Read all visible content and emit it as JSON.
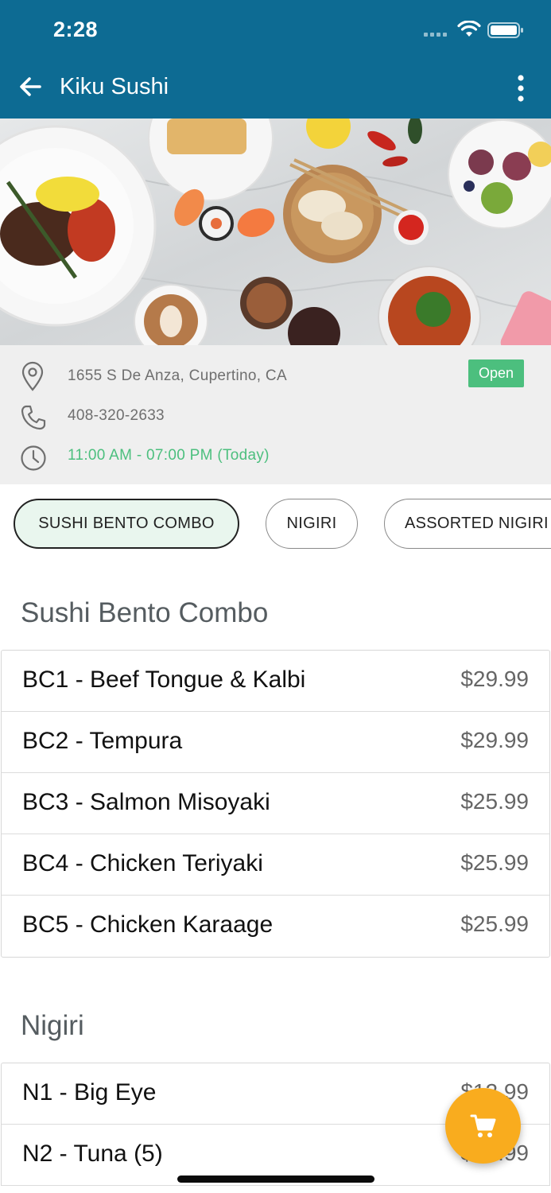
{
  "status_bar": {
    "time": "2:28"
  },
  "app_bar": {
    "title": "Kiku Sushi",
    "back_icon": "arrow-left-icon",
    "menu_icon": "more-vertical-icon"
  },
  "restaurant": {
    "address": "1655 S De Anza, Cupertino, CA",
    "phone": "408-320-2633",
    "hours": "11:00 AM - 07:00 PM (Today)",
    "status": "Open"
  },
  "categories": [
    {
      "label": "SUSHI BENTO COMBO",
      "active": true
    },
    {
      "label": "NIGIRI",
      "active": false
    },
    {
      "label": "ASSORTED NIGIRI",
      "active": false
    }
  ],
  "sections": [
    {
      "title": "Sushi Bento Combo",
      "items": [
        {
          "name": "BC1 - Beef Tongue & Kalbi",
          "price": "$29.99"
        },
        {
          "name": "BC2 - Tempura",
          "price": "$29.99"
        },
        {
          "name": "BC3 - Salmon Misoyaki",
          "price": "$25.99"
        },
        {
          "name": "BC4 - Chicken Teriyaki",
          "price": "$25.99"
        },
        {
          "name": "BC5 - Chicken Karaage",
          "price": "$25.99"
        }
      ]
    },
    {
      "title": "Nigiri",
      "items": [
        {
          "name": "N1 - Big Eye",
          "price": "$12.99"
        },
        {
          "name": "N2 - Tuna (5)",
          "price": "$12.99"
        }
      ]
    }
  ],
  "colors": {
    "app_bar": "#0d6b93",
    "open_badge": "#4cbf7e",
    "cart_fab": "#f9ac1e",
    "active_chip": "#e9f6ee"
  },
  "cart": {
    "icon": "shopping-cart-icon"
  }
}
